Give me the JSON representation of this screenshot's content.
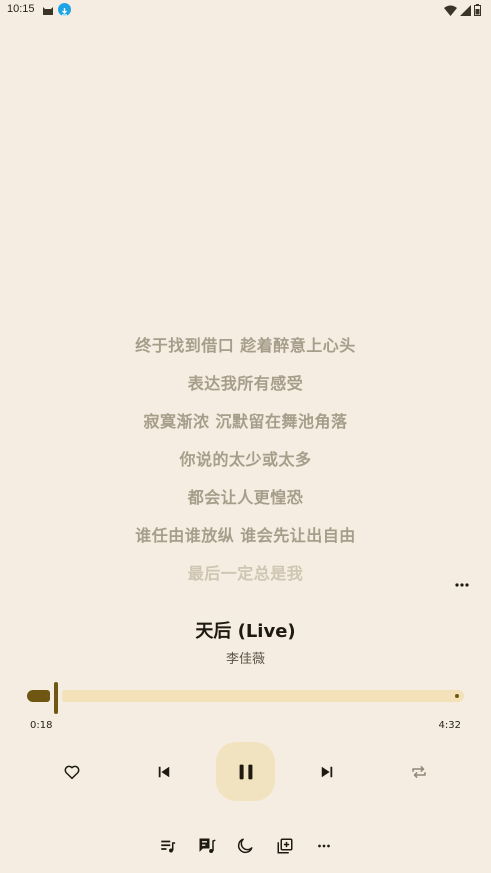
{
  "status_bar": {
    "time": "10:15",
    "icons": [
      "cat-notification-icon",
      "download-icon",
      "wifi-icon",
      "signal-icon",
      "battery-icon"
    ]
  },
  "lyrics": [
    "终于找到借口 趁着醉意上心头",
    "表达我所有感受",
    "寂寞渐浓 沉默留在舞池角落",
    "你说的太少或太多",
    "都会让人更惶恐",
    "谁任由谁放纵 谁会先让出自由",
    "最后一定总是我"
  ],
  "song": {
    "title": "天后 (Live)",
    "artist": "李佳薇"
  },
  "playback": {
    "elapsed": "0:18",
    "total": "4:32",
    "progress_fraction": 0.066
  },
  "controls": {
    "favorite": "heart-outline-icon",
    "previous": "skip-previous-icon",
    "play_pause": "pause-icon",
    "next": "skip-next-icon",
    "repeat": "repeat-icon"
  },
  "bottom_bar": [
    "queue-icon",
    "lyrics-icon",
    "sleep-timer-icon",
    "add-to-playlist-icon",
    "more-icon"
  ],
  "colors": {
    "background": "#f5ede1",
    "accent": "#6f5713",
    "track": "#f2e1b9",
    "lyric_text": "#a79d8b"
  }
}
